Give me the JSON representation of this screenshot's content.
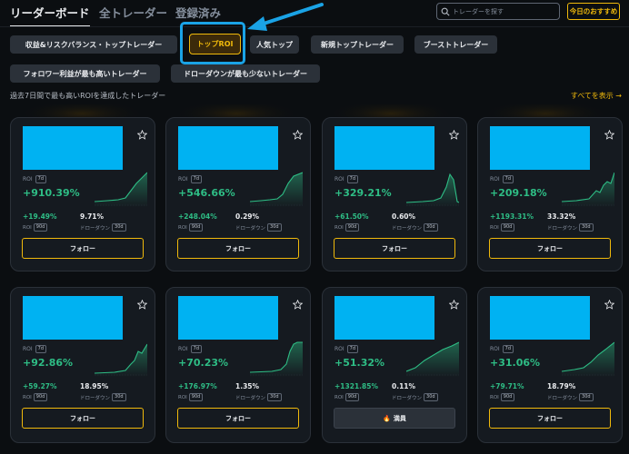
{
  "nav": {
    "tabs": [
      "リーダーボード",
      "全トレーダー",
      "登録済み"
    ],
    "search_placeholder": "トレーダーを探す",
    "todays_pick": "今日のおすすめ"
  },
  "filters": [
    "収益&リスクバランス・トップトレーダー",
    "トップROI",
    "人気トップ",
    "新規トップトレーダー",
    "ブーストトレーダー",
    "フォロワー利益が最も高いトレーダー",
    "ドローダウンが最も少ないトレーダー"
  ],
  "section": {
    "subtitle": "過去7日間で最も高いROIを達成したトレーダー",
    "view_all": "すべてを表示 →"
  },
  "colors": {
    "accent": "#f0b90b",
    "positive": "#2ebd85",
    "banner": "#00b2f2",
    "highlight": "#1aa3e6"
  },
  "cards": [
    {
      "roi_label": "ROI",
      "period": "7d",
      "roi": "+910.39%",
      "stat1_value": "+19.49%",
      "stat1_label": "ROI",
      "stat1_period": "90d",
      "stat2_value": "9.71%",
      "stat2_label": "ドローダウン",
      "stat2_period": "30d",
      "button": "フォロー",
      "button_icon": ""
    },
    {
      "roi_label": "ROI",
      "period": "7d",
      "roi": "+546.66%",
      "stat1_value": "+248.04%",
      "stat1_label": "ROI",
      "stat1_period": "90d",
      "stat2_value": "0.29%",
      "stat2_label": "ドローダウン",
      "stat2_period": "30d",
      "button": "フォロー",
      "button_icon": ""
    },
    {
      "roi_label": "ROI",
      "period": "7d",
      "roi": "+329.21%",
      "stat1_value": "+61.50%",
      "stat1_label": "ROI",
      "stat1_period": "90d",
      "stat2_value": "0.60%",
      "stat2_label": "ドローダウン",
      "stat2_period": "30d",
      "button": "フォロー",
      "button_icon": ""
    },
    {
      "roi_label": "ROI",
      "period": "7d",
      "roi": "+209.18%",
      "stat1_value": "+1193.31%",
      "stat1_label": "ROI",
      "stat1_period": "90d",
      "stat2_value": "33.32%",
      "stat2_label": "ドローダウン",
      "stat2_period": "30d",
      "button": "フォロー",
      "button_icon": ""
    },
    {
      "roi_label": "ROI",
      "period": "7d",
      "roi": "+92.86%",
      "stat1_value": "+59.27%",
      "stat1_label": "ROI",
      "stat1_period": "90d",
      "stat2_value": "18.95%",
      "stat2_label": "ドローダウン",
      "stat2_period": "30d",
      "button": "フォロー",
      "button_icon": ""
    },
    {
      "roi_label": "ROI",
      "period": "7d",
      "roi": "+70.23%",
      "stat1_value": "+176.97%",
      "stat1_label": "ROI",
      "stat1_period": "90d",
      "stat2_value": "1.35%",
      "stat2_label": "ドローダウン",
      "stat2_period": "30d",
      "button": "フォロー",
      "button_icon": ""
    },
    {
      "roi_label": "ROI",
      "period": "7d",
      "roi": "+51.32%",
      "stat1_value": "+1321.85%",
      "stat1_label": "ROI",
      "stat1_period": "90d",
      "stat2_value": "0.11%",
      "stat2_label": "ドローダウン",
      "stat2_period": "30d",
      "button": "満員",
      "button_icon": "🔥"
    },
    {
      "roi_label": "ROI",
      "period": "7d",
      "roi": "+31.06%",
      "stat1_value": "+79.71%",
      "stat1_label": "ROI",
      "stat1_period": "90d",
      "stat2_value": "18.79%",
      "stat2_label": "ドローダウン",
      "stat2_period": "30d",
      "button": "フォロー",
      "button_icon": ""
    }
  ]
}
